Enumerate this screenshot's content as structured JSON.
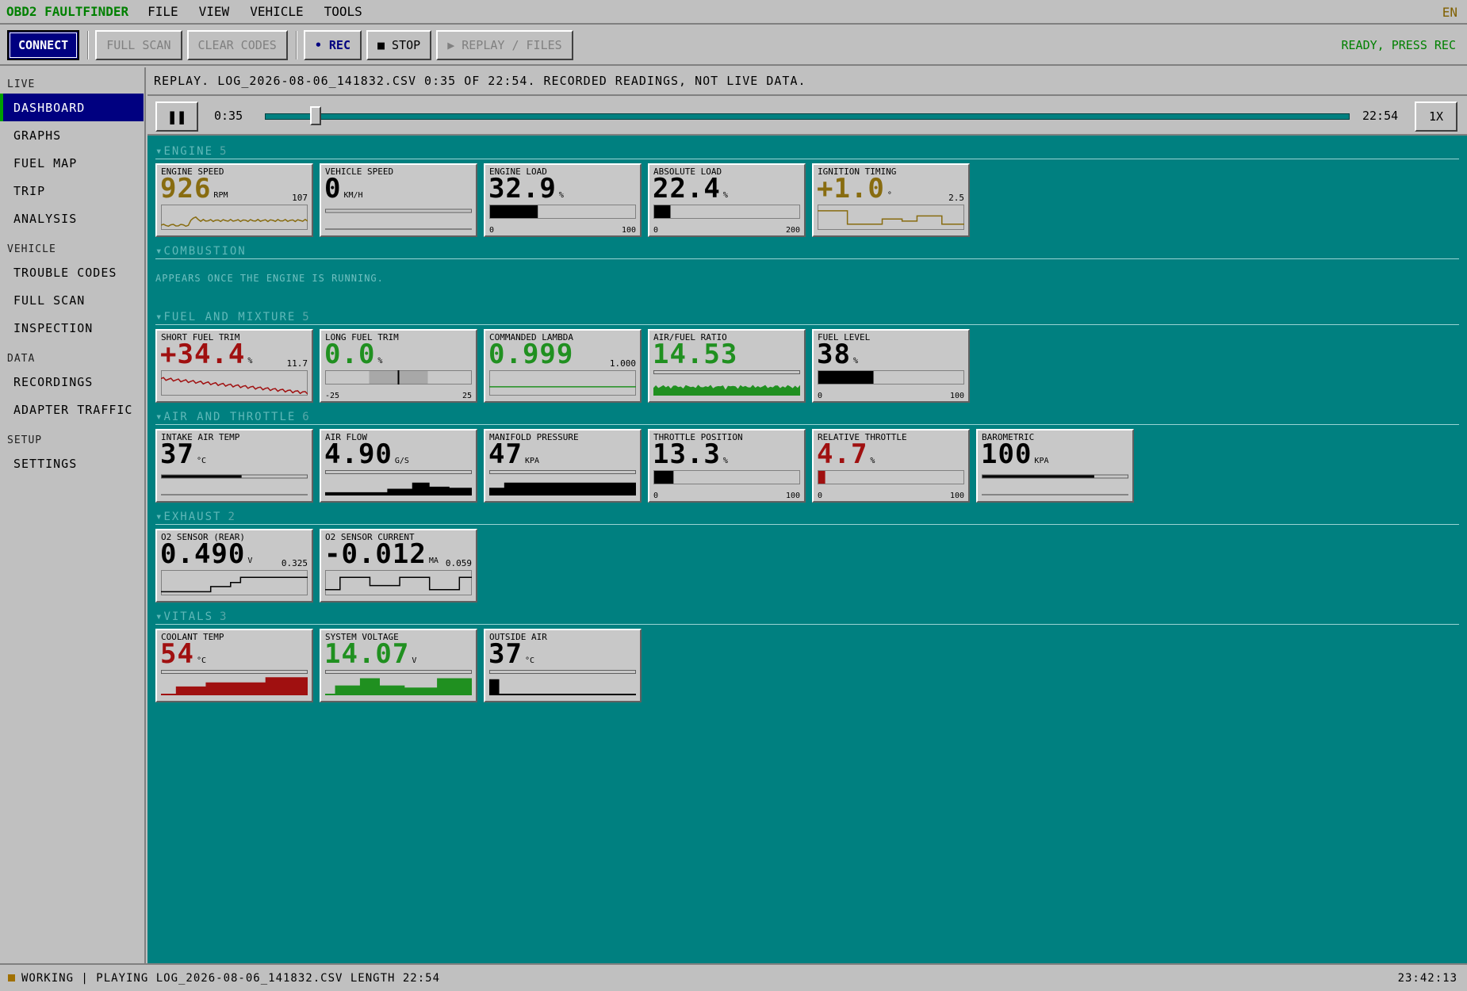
{
  "menubar": {
    "app_title": "OBD2 FAULTFINDER",
    "menus": [
      "FILE",
      "VIEW",
      "VEHICLE",
      "TOOLS"
    ],
    "language": "EN"
  },
  "toolbar": {
    "connect": "CONNECT",
    "full_scan": "FULL SCAN",
    "clear_codes": "CLEAR CODES",
    "rec": "• REC",
    "stop": "■ STOP",
    "replay": "▶ REPLAY / FILES",
    "status": "READY, PRESS REC"
  },
  "sidebar": {
    "sections": [
      {
        "title": "LIVE",
        "items": [
          "DASHBOARD",
          "GRAPHS",
          "FUEL MAP",
          "TRIP",
          "ANALYSIS"
        ]
      },
      {
        "title": "VEHICLE",
        "items": [
          "TROUBLE CODES",
          "FULL SCAN",
          "INSPECTION"
        ]
      },
      {
        "title": "DATA",
        "items": [
          "RECORDINGS",
          "ADAPTER TRAFFIC"
        ]
      },
      {
        "title": "SETUP",
        "items": [
          "SETTINGS"
        ]
      }
    ],
    "active": "DASHBOARD"
  },
  "replay": {
    "banner": "REPLAY. LOG_2026-08-06_141832.CSV 0:35 OF 22:54. RECORDED READINGS, NOT LIVE DATA.",
    "pause": "❚❚",
    "current": "0:35",
    "length": "22:54",
    "progress": 0.0255,
    "speed": "1X"
  },
  "colors": {
    "amber": "#886c10",
    "red": "#a01010",
    "green": "#209020",
    "black": "#000000",
    "teal": "#008080",
    "navy": "#000080"
  },
  "groups": [
    {
      "title": "ENGINE",
      "count": "5",
      "tiles": [
        {
          "label": "ENGINE SPEED",
          "value": "926",
          "unit": "RPM",
          "ref": "107",
          "color": "amber",
          "kind": "spark",
          "shape": "rpm"
        },
        {
          "label": "VEHICLE SPEED",
          "value": "0",
          "unit": "KM/H",
          "color": "black",
          "kind": "flatline"
        },
        {
          "label": "ENGINE LOAD",
          "value": "32.9",
          "unit": "%",
          "color": "black",
          "kind": "bar",
          "fill": 0.329,
          "min": "0",
          "max": "100"
        },
        {
          "label": "ABSOLUTE LOAD",
          "value": "22.4",
          "unit": "%",
          "color": "black",
          "kind": "bar",
          "fill": 0.112,
          "min": "0",
          "max": "200"
        },
        {
          "label": "IGNITION TIMING",
          "value": "+1.0",
          "unit": "°",
          "ref": "2.5",
          "color": "amber",
          "kind": "spark",
          "shape": "timing"
        }
      ]
    },
    {
      "title": "COMBUSTION",
      "count": "",
      "note": "APPEARS ONCE THE ENGINE IS RUNNING.",
      "tiles": []
    },
    {
      "title": "FUEL AND MIXTURE",
      "count": "5",
      "tiles": [
        {
          "label": "SHORT FUEL TRIM",
          "value": "+34.4",
          "unit": "%",
          "ref": "11.7",
          "color": "red",
          "kind": "spark",
          "shape": "trim"
        },
        {
          "label": "LONG FUEL TRIM",
          "value": "0.0",
          "unit": "%",
          "color": "green",
          "kind": "center",
          "min": "-25",
          "max": "25"
        },
        {
          "label": "COMMANDED LAMBDA",
          "value": "0.999",
          "unit": "",
          "ref": "1.000",
          "color": "green",
          "kind": "spark",
          "shape": "lambda"
        },
        {
          "label": "AIR/FUEL RATIO",
          "value": "14.53",
          "unit": "",
          "color": "green",
          "kind": "spark",
          "shape": "afr"
        },
        {
          "label": "FUEL LEVEL",
          "value": "38",
          "unit": "%",
          "color": "black",
          "kind": "bar",
          "fill": 0.38,
          "min": "0",
          "max": "100"
        }
      ]
    },
    {
      "title": "AIR AND THROTTLE",
      "count": "6",
      "tiles": [
        {
          "label": "INTAKE AIR TEMP",
          "value": "37",
          "unit": "°C",
          "color": "black",
          "kind": "flatbar",
          "fill": 0.55
        },
        {
          "label": "AIR FLOW",
          "value": "4.90",
          "unit": "G/S",
          "color": "black",
          "kind": "spark",
          "shape": "maf"
        },
        {
          "label": "MANIFOLD PRESSURE",
          "value": "47",
          "unit": "KPA",
          "color": "black",
          "kind": "spark",
          "shape": "map"
        },
        {
          "label": "THROTTLE POSITION",
          "value": "13.3",
          "unit": "%",
          "color": "black",
          "kind": "bar",
          "fill": 0.133,
          "min": "0",
          "max": "100"
        },
        {
          "label": "RELATIVE THROTTLE",
          "value": "4.7",
          "unit": "%",
          "color": "red",
          "kind": "bar",
          "fill": 0.047,
          "min": "0",
          "max": "100"
        },
        {
          "label": "BAROMETRIC",
          "value": "100",
          "unit": "KPA",
          "color": "black",
          "kind": "flatbar",
          "fill": 0.77
        }
      ]
    },
    {
      "title": "EXHAUST",
      "count": "2",
      "tiles": [
        {
          "label": "O2 SENSOR (REAR)",
          "value": "0.490",
          "unit": "V",
          "ref": "0.325",
          "color": "black",
          "kind": "spark",
          "shape": "o2rear"
        },
        {
          "label": "O2 SENSOR CURRENT",
          "value": "-0.012",
          "unit": "MA",
          "ref": "0.059",
          "color": "black",
          "kind": "spark",
          "shape": "o2cur"
        }
      ]
    },
    {
      "title": "VITALS",
      "count": "3",
      "tiles": [
        {
          "label": "COOLANT TEMP",
          "value": "54",
          "unit": "°C",
          "color": "red",
          "kind": "spark",
          "shape": "coolant"
        },
        {
          "label": "SYSTEM VOLTAGE",
          "value": "14.07",
          "unit": "V",
          "color": "green",
          "kind": "spark",
          "shape": "volt"
        },
        {
          "label": "OUTSIDE AIR",
          "value": "37",
          "unit": "°C",
          "color": "black",
          "kind": "spark",
          "shape": "outside"
        }
      ]
    }
  ],
  "statusbar": {
    "text": "WORKING | PLAYING LOG_2026-08-06_141832.CSV LENGTH 22:54",
    "clock": "23:42:13"
  }
}
